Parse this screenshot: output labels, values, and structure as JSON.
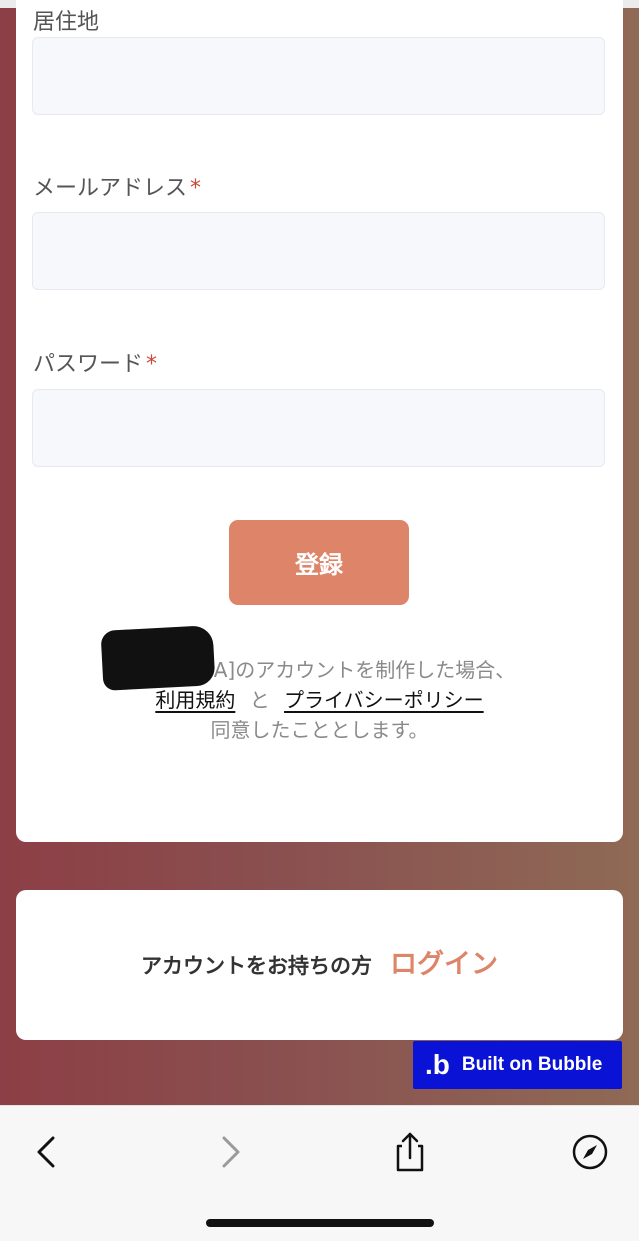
{
  "form": {
    "residence_label": "居住地",
    "email_label": "メールアドレス",
    "password_label": "パスワード",
    "required_mark": "*",
    "submit_label": "登録"
  },
  "notice": {
    "line1_visible": "A]のアカウントを制作した場合、",
    "terms_link": "利用規約",
    "and": "と",
    "privacy_link": "プライバシーポリシー",
    "line3": "同意したこととします。"
  },
  "login_card": {
    "prompt": "アカウントをお持ちの方",
    "login_link": "ログイン"
  },
  "badge": {
    "logo": ".b",
    "text": "Built on Bubble"
  },
  "toolbar": {
    "back_icon": "chevron-left",
    "forward_icon": "chevron-right",
    "share_icon": "share",
    "compass_icon": "compass"
  },
  "colors": {
    "accent": "#dd8469",
    "required": "#c94a3a",
    "badge_bg": "#0a12d6"
  }
}
